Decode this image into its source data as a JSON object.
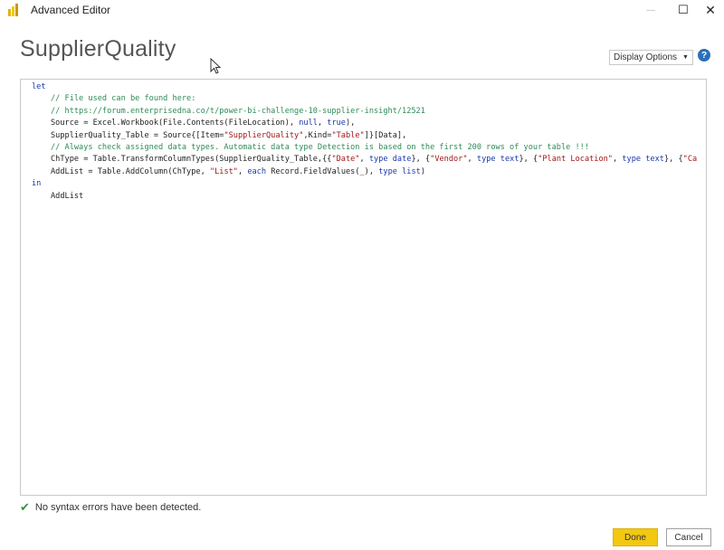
{
  "window": {
    "title": "Advanced Editor",
    "controls": {
      "minimize": "—",
      "maximize": "☐",
      "close": "✕"
    }
  },
  "header": {
    "query_name": "SupplierQuality",
    "display_options_label": "Display Options",
    "help_label": "?"
  },
  "editor": {
    "lines": [
      {
        "indent": 0,
        "tokens": [
          {
            "t": "let",
            "c": "kw"
          }
        ]
      },
      {
        "indent": 1,
        "tokens": [
          {
            "t": "// File used can be found here:",
            "c": "cm"
          }
        ]
      },
      {
        "indent": 1,
        "tokens": [
          {
            "t": "// https://forum.enterprisedna.co/t/power-bi-challenge-10-supplier-insight/12521",
            "c": "cm"
          }
        ]
      },
      {
        "indent": 1,
        "tokens": [
          {
            "t": "Source = Excel.Workbook(File.Contents(FileLocation), ",
            "c": ""
          },
          {
            "t": "null",
            "c": "kw"
          },
          {
            "t": ", ",
            "c": ""
          },
          {
            "t": "true",
            "c": "kw"
          },
          {
            "t": "),",
            "c": ""
          }
        ]
      },
      {
        "indent": 1,
        "tokens": [
          {
            "t": "SupplierQuality_Table = Source{[Item=",
            "c": ""
          },
          {
            "t": "\"SupplierQuality\"",
            "c": "st"
          },
          {
            "t": ",Kind=",
            "c": ""
          },
          {
            "t": "\"Table\"",
            "c": "st"
          },
          {
            "t": "]}[Data],",
            "c": ""
          }
        ]
      },
      {
        "indent": 1,
        "tokens": [
          {
            "t": "// Always check assigned data types. Automatic data type Detection is based on the first 200 rows of your table !!!",
            "c": "cm"
          }
        ]
      },
      {
        "indent": 1,
        "tokens": [
          {
            "t": "ChType = Table.TransformColumnTypes(SupplierQuality_Table,{{",
            "c": ""
          },
          {
            "t": "\"Date\"",
            "c": "st"
          },
          {
            "t": ", ",
            "c": ""
          },
          {
            "t": "type",
            "c": "kw"
          },
          {
            "t": " ",
            "c": ""
          },
          {
            "t": "date",
            "c": "kw"
          },
          {
            "t": "}, {",
            "c": ""
          },
          {
            "t": "\"Vendor\"",
            "c": "st"
          },
          {
            "t": ", ",
            "c": ""
          },
          {
            "t": "type",
            "c": "kw"
          },
          {
            "t": " ",
            "c": ""
          },
          {
            "t": "text",
            "c": "kw"
          },
          {
            "t": "}, {",
            "c": ""
          },
          {
            "t": "\"Plant Location\"",
            "c": "st"
          },
          {
            "t": ", ",
            "c": ""
          },
          {
            "t": "type",
            "c": "kw"
          },
          {
            "t": " ",
            "c": ""
          },
          {
            "t": "text",
            "c": "kw"
          },
          {
            "t": "}, {",
            "c": ""
          },
          {
            "t": "\"Ca",
            "c": "st"
          }
        ]
      },
      {
        "indent": 1,
        "tokens": [
          {
            "t": "AddList = Table.AddColumn(ChType, ",
            "c": ""
          },
          {
            "t": "\"List\"",
            "c": "st"
          },
          {
            "t": ", ",
            "c": ""
          },
          {
            "t": "each",
            "c": "kw"
          },
          {
            "t": " Record.FieldValues(_), ",
            "c": ""
          },
          {
            "t": "type",
            "c": "kw"
          },
          {
            "t": " ",
            "c": ""
          },
          {
            "t": "list",
            "c": "kw"
          },
          {
            "t": ")",
            "c": ""
          }
        ]
      },
      {
        "indent": 0,
        "tokens": [
          {
            "t": "in",
            "c": "kw"
          }
        ]
      },
      {
        "indent": 1,
        "tokens": [
          {
            "t": "AddList",
            "c": ""
          }
        ]
      }
    ]
  },
  "status": {
    "message": "No syntax errors have been detected."
  },
  "footer": {
    "done_label": "Done",
    "cancel_label": "Cancel"
  },
  "colors": {
    "accent": "#f2c811",
    "keyword": "#1a37b0",
    "comment": "#2e8b57",
    "string": "#a31515",
    "help": "#2a6fb8"
  }
}
